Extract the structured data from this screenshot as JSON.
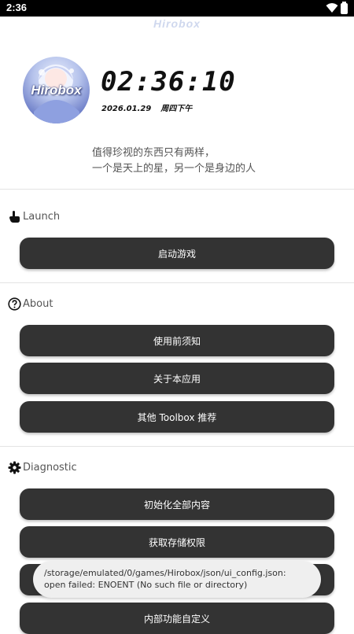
{
  "status_bar": {
    "time": "2:36",
    "icons": [
      "wifi-icon",
      "battery-icon"
    ]
  },
  "app": {
    "title": "Hirobox"
  },
  "avatar": {
    "text": "Hirobox"
  },
  "clock": {
    "time": "02:36:10",
    "date": "2026.01.29",
    "weekday": "周四下午"
  },
  "quote": {
    "line1": "值得珍视的东西只有两样，",
    "line2": "一个是天上的星，另一个是身边的人"
  },
  "sections": {
    "launch": {
      "label": "Launch",
      "icon": "hand-pointer-icon",
      "buttons": [
        "启动游戏"
      ]
    },
    "about": {
      "label": "About",
      "icon": "question-icon",
      "buttons": [
        "使用前须知",
        "关于本应用",
        "其他 Toolbox 推荐"
      ]
    },
    "diagnostic": {
      "label": "Diagnostic",
      "icon": "gear-icon",
      "buttons": [
        "初始化全部内容",
        "获取存储权限",
        "",
        "内部功能自定义"
      ]
    }
  },
  "toast": {
    "message": "/storage/emulated/0/games/Hirobox/json/ui_config.json: open failed: ENOENT (No such file or directory)"
  },
  "colors": {
    "button_bg": "#333333",
    "button_text": "#ffffff",
    "background": "#ffffff"
  }
}
